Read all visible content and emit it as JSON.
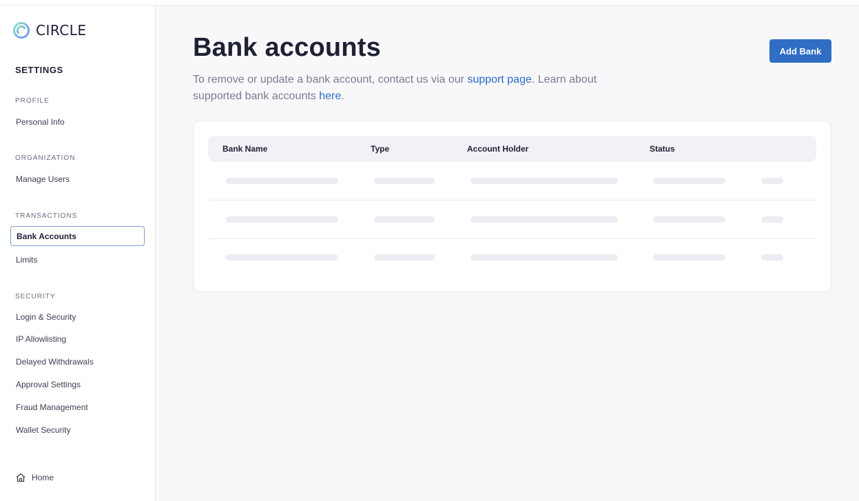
{
  "brand": {
    "name": "CIRCLE"
  },
  "sidebar": {
    "title": "SETTINGS",
    "sections": [
      {
        "label": "PROFILE",
        "items": [
          "Personal Info"
        ]
      },
      {
        "label": "ORGANIZATION",
        "items": [
          "Manage Users"
        ]
      },
      {
        "label": "TRANSACTIONS",
        "items": [
          "Bank Accounts",
          "Limits"
        ]
      },
      {
        "label": "SECURITY",
        "items": [
          "Login & Security",
          "IP Allowlisting",
          "Delayed Withdrawals",
          "Approval Settings",
          "Fraud Management",
          "Wallet Security"
        ]
      }
    ],
    "active_item": "Bank Accounts",
    "home_label": "Home"
  },
  "main": {
    "title": "Bank accounts",
    "subtitle_part1": "To remove or update a bank account, contact us via our ",
    "support_link": "support page",
    "subtitle_part2": ". Learn about supported bank accounts ",
    "here_link": "here",
    "subtitle_part3": ".",
    "add_button": "Add Bank"
  },
  "table": {
    "columns": [
      "Bank Name",
      "Type",
      "Account Holder",
      "Status"
    ],
    "rows_loading": 3
  },
  "colors": {
    "accent": "#2f6ec4",
    "link": "#2b6cc4",
    "background": "#f8f8fb",
    "skeleton": "#ececf2"
  },
  "icons": [
    "circle-logo-icon",
    "home-icon"
  ]
}
